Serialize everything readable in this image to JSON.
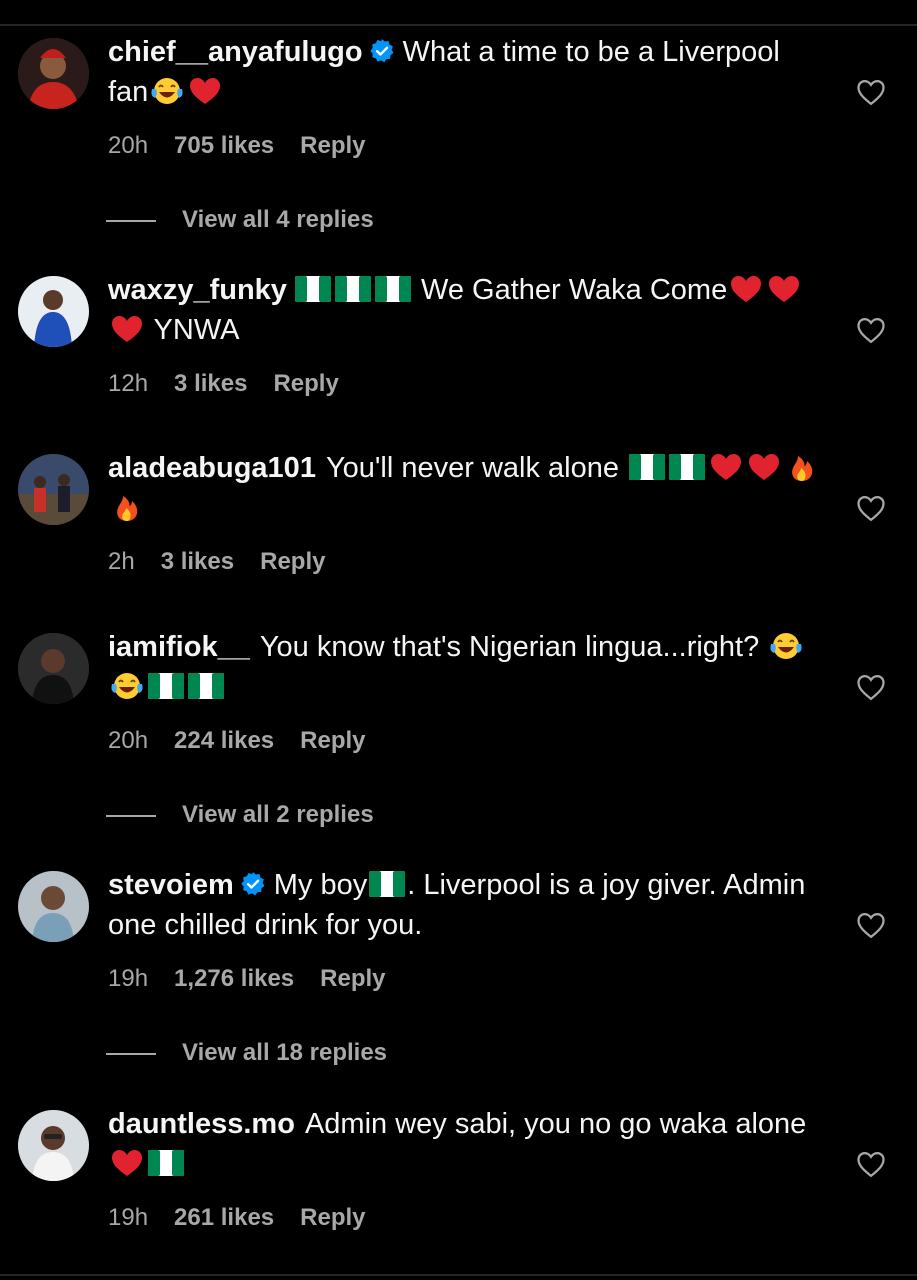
{
  "comments": [
    {
      "username": "chief__anyafulugo",
      "verified": true,
      "text_parts": [
        "What a time to be a Liverpool fan"
      ],
      "time": "20h",
      "likes": "705 likes",
      "reply": "Reply",
      "view_replies": "View all 4 replies"
    },
    {
      "username": "waxzy_funky",
      "verified": false,
      "text_parts": [
        "We Gather Waka Come",
        "YNWA"
      ],
      "time": "12h",
      "likes": "3 likes",
      "reply": "Reply"
    },
    {
      "username": "aladeabuga101",
      "verified": false,
      "text_parts": [
        "You'll never walk alone"
      ],
      "time": "2h",
      "likes": "3 likes",
      "reply": "Reply"
    },
    {
      "username": "iamifiok__",
      "verified": false,
      "text_parts": [
        "You know that's Nigerian lingua...right?"
      ],
      "time": "20h",
      "likes": "224 likes",
      "reply": "Reply",
      "view_replies": "View all 2 replies"
    },
    {
      "username": "stevoiem",
      "verified": true,
      "text_parts": [
        "My boy",
        ". Liverpool is a joy giver. Admin one chilled drink for you."
      ],
      "time": "19h",
      "likes": "1,276 likes",
      "reply": "Reply",
      "view_replies": "View all 18 replies"
    },
    {
      "username": "dauntless.mo",
      "verified": false,
      "text_parts": [
        "Admin wey sabi, you no go waka alone"
      ],
      "time": "19h",
      "likes": "261 likes",
      "reply": "Reply"
    }
  ],
  "icons": {
    "like": "heart-outline-icon",
    "verified": "verified-badge-icon",
    "emoji_laugh": "tears-of-joy-emoji",
    "emoji_heart": "red-heart-emoji",
    "emoji_fire": "fire-emoji",
    "flag": "nigeria-flag-emoji"
  },
  "colors": {
    "background": "#000000",
    "text": "#f5f5f5",
    "meta": "#a8a8a8",
    "verified_blue": "#0095f6",
    "heart_red": "#e0232e",
    "flag_green": "#008751"
  }
}
